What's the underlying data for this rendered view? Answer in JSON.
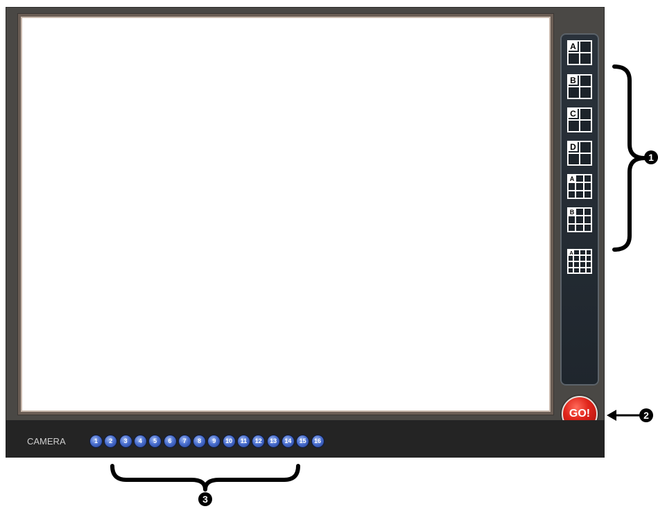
{
  "layout_buttons": [
    {
      "label": "A",
      "icon": "quad-split-a-icon",
      "grid": 2
    },
    {
      "label": "B",
      "icon": "quad-split-b-icon",
      "grid": 2
    },
    {
      "label": "C",
      "icon": "quad-split-c-icon",
      "grid": 2
    },
    {
      "label": "D",
      "icon": "quad-split-d-icon",
      "grid": 2
    },
    {
      "label": "A",
      "icon": "nine-split-a-icon",
      "grid": 3
    },
    {
      "label": "B",
      "icon": "nine-split-b-icon",
      "grid": 3
    },
    {
      "label": "A",
      "icon": "sixteen-split-icon",
      "grid": 4
    }
  ],
  "go_button": {
    "label": "GO!",
    "color": "#e0251b"
  },
  "camera_bar": {
    "label": "CAMERA",
    "cameras": [
      "1",
      "2",
      "3",
      "4",
      "5",
      "6",
      "7",
      "8",
      "9",
      "10",
      "11",
      "12",
      "13",
      "14",
      "15",
      "16"
    ]
  },
  "callouts": {
    "one": "1",
    "two": "2",
    "three": "3"
  },
  "colors": {
    "frame": "#4a4845",
    "camera_button": "#4a6fcf",
    "panel": "#2a323b"
  }
}
